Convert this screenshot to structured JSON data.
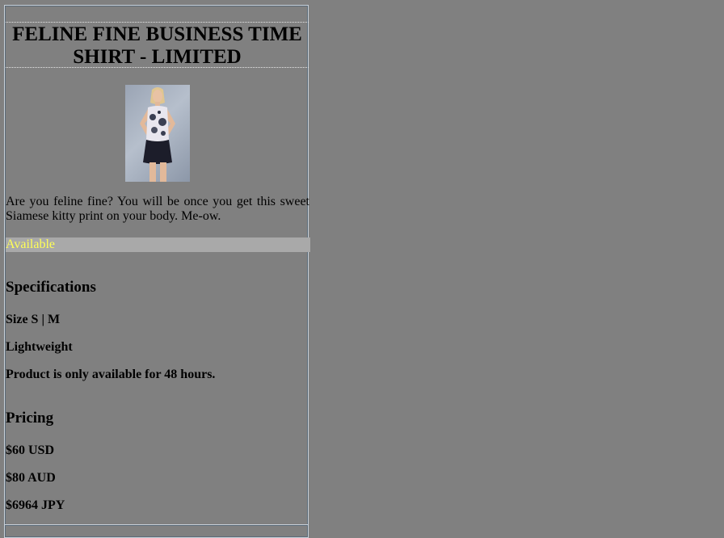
{
  "product": {
    "title": "FELINE FINE BUSINESS TIME SHIRT - LIMITED",
    "image_alt": "Model wearing Siamese kitty print shirt",
    "description": "Are you feline fine? You will be once you get this sweet Siamese kitty print on your body. Me-ow.",
    "availability": "Available"
  },
  "specifications": {
    "heading": "Specifications",
    "items": [
      "Size S | M",
      "Lightweight",
      "Product is only available for 48 hours."
    ]
  },
  "pricing": {
    "heading": "Pricing",
    "items": [
      "$60 USD",
      "$80 AUD",
      "$6964 JPY"
    ]
  },
  "colors": {
    "background": "#808080",
    "availability_bg": "#a9a9a9",
    "availability_text": "#ffff55"
  }
}
